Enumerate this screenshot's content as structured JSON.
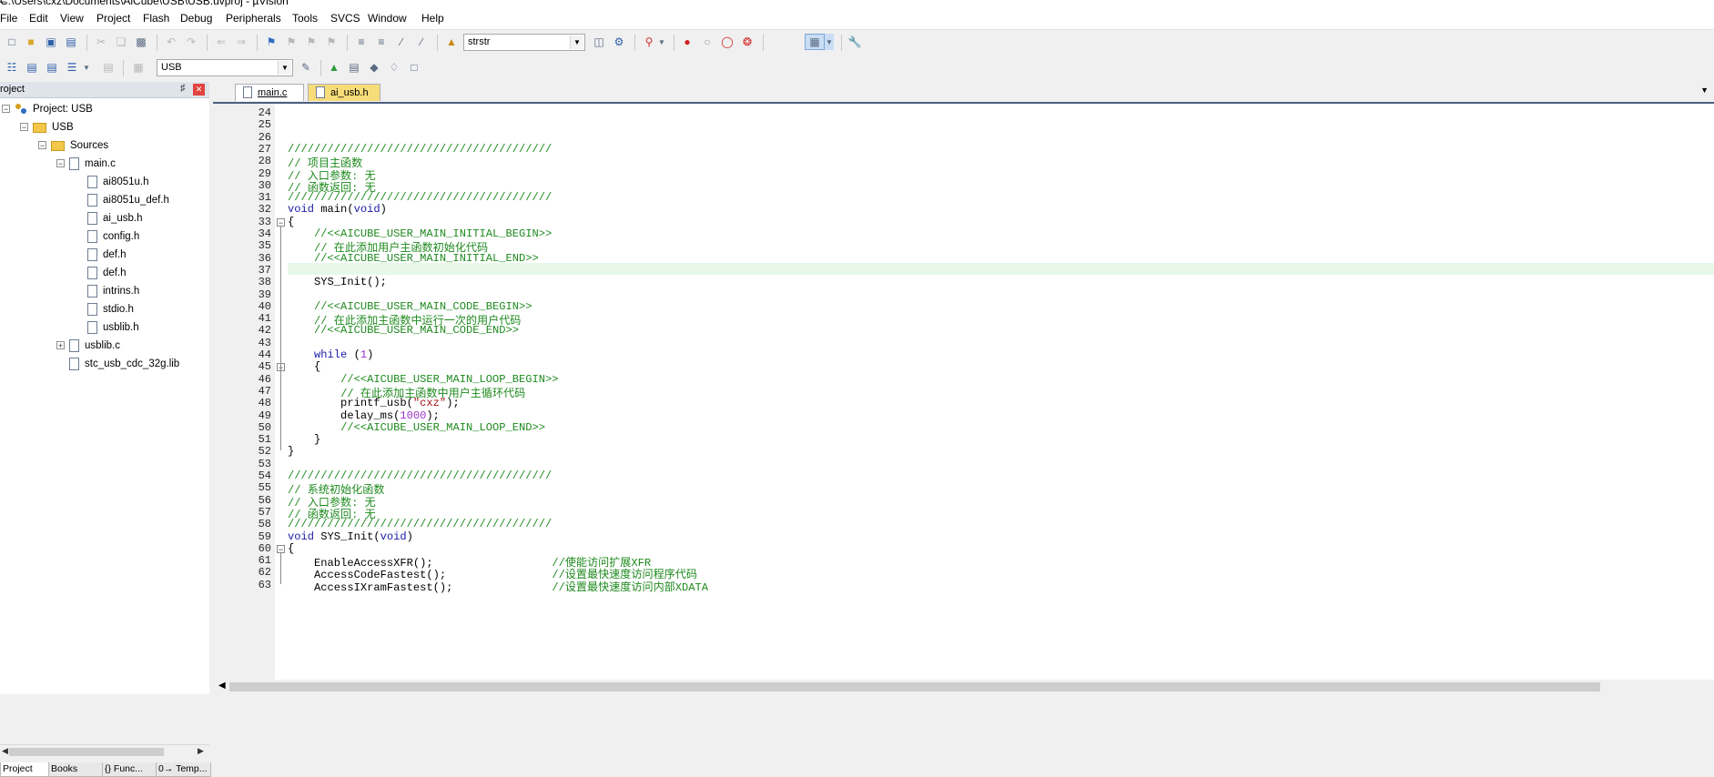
{
  "window": {
    "title": "C:\\Users\\cxz\\Documents\\AiCube\\USB\\USB.uvproj - µVision",
    "minimize_glyph": "–"
  },
  "menu": [
    "File",
    "Edit",
    "View",
    "Project",
    "Flash",
    "Debug",
    "Peripherals",
    "Tools",
    "SVCS",
    "Window",
    "Help"
  ],
  "toolbar": {
    "find_value": "strstr",
    "target_value": "USB"
  },
  "project_panel": {
    "title": "roject",
    "tree": [
      {
        "label": "Project: USB",
        "type": "project",
        "expander": "−"
      },
      {
        "label": "USB",
        "type": "folder",
        "expander": "−"
      },
      {
        "label": "Sources",
        "type": "folder",
        "expander": "−"
      },
      {
        "label": "main.c",
        "type": "file",
        "expander": "−"
      },
      {
        "label": "ai8051u.h",
        "type": "file"
      },
      {
        "label": "ai8051u_def.h",
        "type": "file"
      },
      {
        "label": "ai_usb.h",
        "type": "file"
      },
      {
        "label": "config.h",
        "type": "file"
      },
      {
        "label": "def.h",
        "type": "file"
      },
      {
        "label": "def.h",
        "type": "file"
      },
      {
        "label": "intrins.h",
        "type": "file"
      },
      {
        "label": "stdio.h",
        "type": "file"
      },
      {
        "label": "usblib.h",
        "type": "file"
      },
      {
        "label": "usblib.c",
        "type": "file",
        "expander": "+"
      },
      {
        "label": "stc_usb_cdc_32g.lib",
        "type": "file"
      }
    ],
    "tabs": [
      "Project",
      "Books",
      "{} Func...",
      "0→ Temp..."
    ]
  },
  "editor": {
    "tabs": [
      {
        "label": "main.c",
        "active": true
      },
      {
        "label": "ai_usb.h",
        "active": false
      }
    ],
    "current_line": 37,
    "lines": [
      {
        "n": 24,
        "code": ""
      },
      {
        "n": 25,
        "code": ""
      },
      {
        "n": 26,
        "code": ""
      },
      {
        "n": 27,
        "code": "////////////////////////////////////////"
      },
      {
        "n": 28,
        "code": "// 项目主函数"
      },
      {
        "n": 29,
        "code": "// 入口参数: 无"
      },
      {
        "n": 30,
        "code": "// 函数返回: 无"
      },
      {
        "n": 31,
        "code": "////////////////////////////////////////"
      },
      {
        "n": 32,
        "code": "void main(void)"
      },
      {
        "n": 33,
        "code": "{"
      },
      {
        "n": 34,
        "code": "    //<<AICUBE_USER_MAIN_INITIAL_BEGIN>>"
      },
      {
        "n": 35,
        "code": "    // 在此添加用户主函数初始化代码"
      },
      {
        "n": 36,
        "code": "    //<<AICUBE_USER_MAIN_INITIAL_END>>"
      },
      {
        "n": 37,
        "code": ""
      },
      {
        "n": 38,
        "code": "    SYS_Init();"
      },
      {
        "n": 39,
        "code": ""
      },
      {
        "n": 40,
        "code": "    //<<AICUBE_USER_MAIN_CODE_BEGIN>>"
      },
      {
        "n": 41,
        "code": "    // 在此添加主函数中运行一次的用户代码"
      },
      {
        "n": 42,
        "code": "    //<<AICUBE_USER_MAIN_CODE_END>>"
      },
      {
        "n": 43,
        "code": ""
      },
      {
        "n": 44,
        "code": "    while (1)"
      },
      {
        "n": 45,
        "code": "    {"
      },
      {
        "n": 46,
        "code": "        //<<AICUBE_USER_MAIN_LOOP_BEGIN>>"
      },
      {
        "n": 47,
        "code": "        // 在此添加主函数中用户主循环代码"
      },
      {
        "n": 48,
        "code": "        printf_usb(\"cxz\");"
      },
      {
        "n": 49,
        "code": "        delay_ms(1000);"
      },
      {
        "n": 50,
        "code": "        //<<AICUBE_USER_MAIN_LOOP_END>>"
      },
      {
        "n": 51,
        "code": "    }"
      },
      {
        "n": 52,
        "code": "}"
      },
      {
        "n": 53,
        "code": ""
      },
      {
        "n": 54,
        "code": "////////////////////////////////////////"
      },
      {
        "n": 55,
        "code": "// 系统初始化函数"
      },
      {
        "n": 56,
        "code": "// 入口参数: 无"
      },
      {
        "n": 57,
        "code": "// 函数返回: 无"
      },
      {
        "n": 58,
        "code": "////////////////////////////////////////"
      },
      {
        "n": 59,
        "code": "void SYS_Init(void)"
      },
      {
        "n": 60,
        "code": "{"
      },
      {
        "n": 61,
        "code": "    EnableAccessXFR();                  //使能访问扩展XFR"
      },
      {
        "n": 62,
        "code": "    AccessCodeFastest();                //设置最快速度访问程序代码"
      },
      {
        "n": 63,
        "code": "    AccessIXramFastest();               //设置最快速度访问内部XDATA"
      }
    ]
  },
  "colors": {
    "keyword": "#1a1aa6",
    "comment": "#1f8a1f",
    "string": "#a31515",
    "number": "#9933cc",
    "current_line": "#e7f8e9"
  }
}
